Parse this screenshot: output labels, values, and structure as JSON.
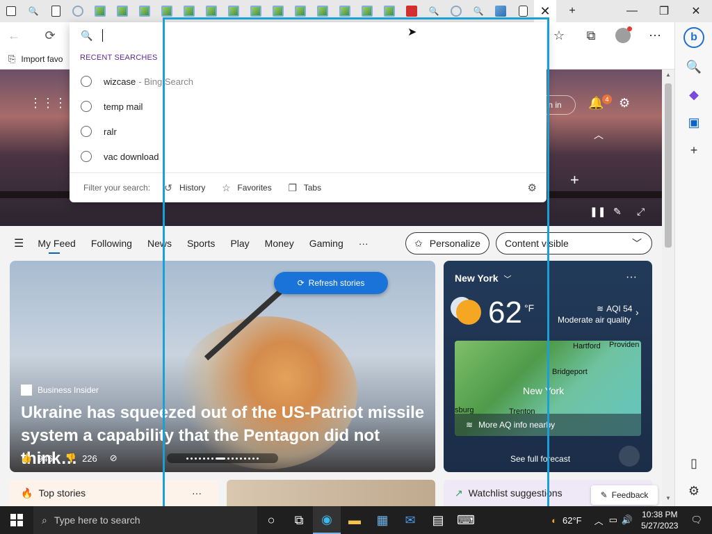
{
  "browser": {
    "close_glyph": "✕",
    "newtab_glyph": "+",
    "minimize_glyph": "—",
    "maximize_glyph": "❐",
    "windowclose_glyph": "✕"
  },
  "favorites_bar": {
    "import_label": "Import favo"
  },
  "hero": {
    "signin_label": "n in",
    "notification_count": "4"
  },
  "address_dropdown": {
    "input_value": "",
    "recent_header": "RECENT SEARCHES",
    "items": [
      {
        "text": "wizcase",
        "suffix": "- Bing Search"
      },
      {
        "text": "temp mail",
        "suffix": ""
      },
      {
        "text": "ralr",
        "suffix": ""
      },
      {
        "text": "vac download",
        "suffix": ""
      }
    ],
    "filter_label": "Filter your search:",
    "filters": [
      "History",
      "Favorites",
      "Tabs"
    ]
  },
  "feed_nav": {
    "items": [
      "My Feed",
      "Following",
      "News",
      "Sports",
      "Play",
      "Money",
      "Gaming"
    ],
    "more": "···",
    "personalize_label": "Personalize",
    "content_label": "Content visible"
  },
  "main_story": {
    "refresh_label": "Refresh stories",
    "source": "Business Insider",
    "headline": "Ukraine has squeezed out of the US-Patriot missile system a capability that the Pentagon did not think…",
    "likes": "946",
    "dislikes": "226"
  },
  "weather": {
    "city": "New York",
    "temp": "62",
    "unit": "°F",
    "aqi": "AQI 54",
    "aqi_desc": "Moderate air quality",
    "map_labels": [
      "Hartford",
      "Providen",
      "Bridgeport",
      "New York",
      "sburg",
      "Trenton"
    ],
    "aq_link": "More AQ info nearby",
    "forecast_link": "See full forecast",
    "more": "···"
  },
  "lower_cards": {
    "top_stories": "Top stories",
    "watchlist": "Watchlist suggestions",
    "feedback": "Feedback",
    "more": "···"
  },
  "taskbar": {
    "search_placeholder": "Type here to search",
    "weather_temp": "62°F",
    "time": "10:38 PM",
    "date": "5/27/2023"
  },
  "colors": {
    "accent": "#0067b8",
    "highlight": "#1aa0d6",
    "refresh": "#1a73d8",
    "recent_header": "#5b2a91"
  }
}
